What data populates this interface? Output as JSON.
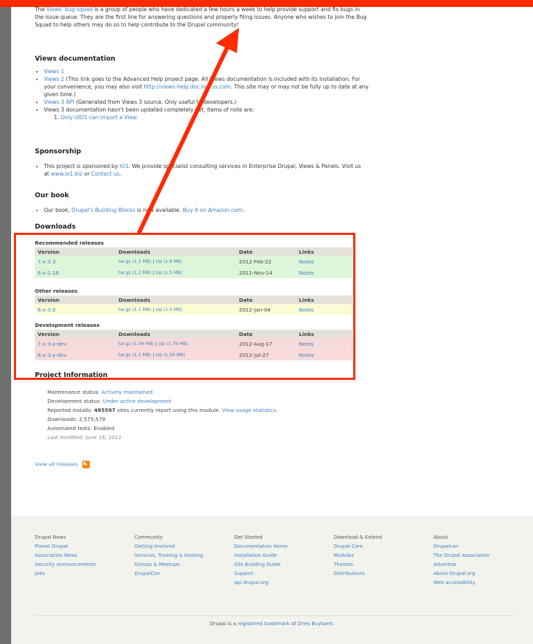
{
  "intro": {
    "pre": "The ",
    "link": "Views' bug squad",
    "text": " is a group of people who have dedicated a few hours a week to help provide support and fix bugs in the issue queue. They are the first line for answering questions and properly filing issues. Anyone who wishes to join the Bug Squad to help others may do so to help contribute to the Drupal community!"
  },
  "docs": {
    "heading": "Views documentation",
    "items": [
      {
        "link": "Views 1",
        "text": ""
      },
      {
        "link": "Views 2",
        "text": " (This link goes to the Advanced Help project page. All Views documentation is included with its installation. For your convenience, you may also visit ",
        "link2": "http://views-help.doc.logrus.com",
        "text2": ". This site may or may not be fully up to date at any given time.)"
      },
      {
        "link": "Views 3 API",
        "text": " (Generated from Views 3 source. Only useful to developers.)"
      },
      {
        "link": "",
        "text": "Views 3 documentation hasn't been updated completely yet. Items of note are:"
      }
    ],
    "subitem": "Only UID1 can import a View."
  },
  "sponsorship": {
    "heading": "Sponsorship",
    "pre": "This project is sponsored by ",
    "link1": "IO1",
    "mid": ". We provide specialist consulting services in Enterprise Drupal, Views & Panels. Visit us at ",
    "link2": "www.io1.biz",
    "or": " or ",
    "link3": "Contact us",
    "end": "."
  },
  "book": {
    "heading": "Our book",
    "pre": "Our book, ",
    "link1": "Drupal's Building Blocks",
    "mid": " is now available. ",
    "link2": "Buy it on Amazon.com",
    "end": "."
  },
  "downloads": {
    "heading": "Downloads",
    "columns": [
      "Version",
      "Downloads",
      "Date",
      "Links"
    ],
    "recommended_caption": "Recommended releases",
    "recommended": [
      {
        "version": "7.x-3.3",
        "tar": "tar.gz",
        "tarsize": "(1.5 MB)",
        "zip": "zip",
        "zipsize": "(1.8 MB)",
        "date": "2012-Feb-22",
        "links": "Notes"
      },
      {
        "version": "6.x-2.16",
        "tar": "tar.gz",
        "tarsize": "(1.2 MB)",
        "zip": "zip",
        "zipsize": "(1.5 MB)",
        "date": "2011-Nov-14",
        "links": "Notes"
      }
    ],
    "other_caption": "Other releases",
    "other": [
      {
        "version": "6.x-3.0",
        "tar": "tar.gz",
        "tarsize": "(1.1 MB)",
        "zip": "zip",
        "zipsize": "(1.5 MB)",
        "date": "2012-Jan-04",
        "links": "Notes"
      }
    ],
    "dev_caption": "Development releases",
    "dev": [
      {
        "version": "7.x-3.x-dev",
        "tar": "tar.gz",
        "tarsize": "(1.56 MB)",
        "zip": "zip",
        "zipsize": "(1.79 MB)",
        "date": "2012-Aug-17",
        "links": "Notes"
      },
      {
        "version": "6.x-3.x-dev",
        "tar": "tar.gz",
        "tarsize": "(1.1 MB)",
        "zip": "zip",
        "zipsize": "(1.26 MB)",
        "date": "2012-Jul-27",
        "links": "Notes"
      }
    ]
  },
  "project_info": {
    "heading": "Project Information",
    "maintenance_label": "Maintenance status: ",
    "maintenance_value": "Actively maintained",
    "development_label": "Development status: ",
    "development_value": "Under active development",
    "installs_label": "Reported installs: ",
    "installs_value": "485597",
    "installs_text": " sites currently report using this module. ",
    "installs_link": "View usage statistics",
    "downloads": "Downloads: 2,575,579",
    "tests": "Automated tests: Enabled",
    "modified": "Last modified: June 16, 2012"
  },
  "view_all": "View all releases",
  "footer": {
    "columns": [
      {
        "title": "Drupal News",
        "links": [
          "Planet Drupal",
          "Association News",
          "Security Announcements",
          "Jobs"
        ]
      },
      {
        "title": "Community",
        "links": [
          "Getting Involved",
          "Services, Training & Hosting",
          "Groups & Meetups",
          "DrupalCon"
        ]
      },
      {
        "title": "Get Started",
        "links": [
          "Documentation Home",
          "Installation Guide",
          "Site Building Guide",
          "Support",
          "api.drupal.org"
        ]
      },
      {
        "title": "Download & Extend",
        "links": [
          "Drupal Core",
          "Modules",
          "Themes",
          "Distributions"
        ]
      },
      {
        "title": "About",
        "links": [
          "Drupalcon",
          "The Drupal Association",
          "Advertise",
          "About Drupal.org",
          "Web accessibility"
        ]
      }
    ],
    "copy_pre": "Drupal is a ",
    "copy_link1": "registered trademark",
    "copy_mid": " of ",
    "copy_link2": "Dries Buytaert",
    "copy_end": "."
  },
  "colors": {
    "annotation": "#ff2a00",
    "link": "#3b7fc4",
    "recommended_row": "#ddf5d8",
    "other_row": "#fbfbd6",
    "dev_row": "#f7dada"
  }
}
